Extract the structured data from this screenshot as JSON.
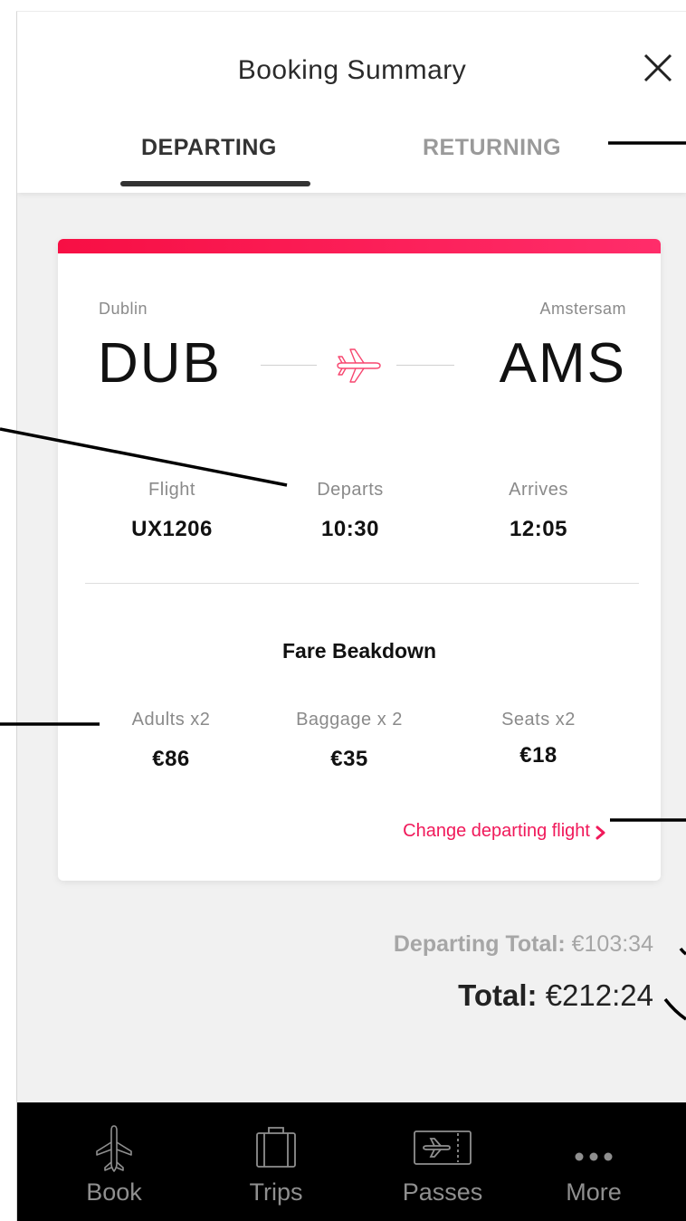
{
  "header": {
    "title": "Booking Summary",
    "close_icon": "close-icon"
  },
  "tabs": [
    {
      "label": "DEPARTING",
      "active": true
    },
    {
      "label": "RETURNING",
      "active": false
    }
  ],
  "card": {
    "accent_color": "#f70f44",
    "origin": {
      "city": "Dublin",
      "code": "DUB"
    },
    "destination": {
      "city": "Amstersam",
      "code": "AMS"
    },
    "route_icon": "airplane-icon",
    "details": [
      {
        "label": "Flight",
        "value": "UX1206"
      },
      {
        "label": "Departs",
        "value": "10:30"
      },
      {
        "label": "Arrives",
        "value": "12:05"
      }
    ],
    "fare_title": "Fare Beakdown",
    "fares": [
      {
        "label": "Adults x2",
        "value": "€86"
      },
      {
        "label": "Baggage x 2",
        "value": "€35"
      },
      {
        "label": "Seats x2",
        "value": "€18"
      }
    ],
    "change_link": "Change departing flight",
    "change_icon": "chevron-right-icon"
  },
  "totals": {
    "departing_label": "Departing Total:",
    "departing_value": "€103:34",
    "total_label": "Total:",
    "total_value": "€212:24"
  },
  "nav": [
    {
      "label": "Book",
      "icon": "airplane-icon"
    },
    {
      "label": "Trips",
      "icon": "suitcase-icon"
    },
    {
      "label": "Passes",
      "icon": "ticket-icon"
    },
    {
      "label": "More",
      "icon": "more-dots-icon"
    }
  ]
}
